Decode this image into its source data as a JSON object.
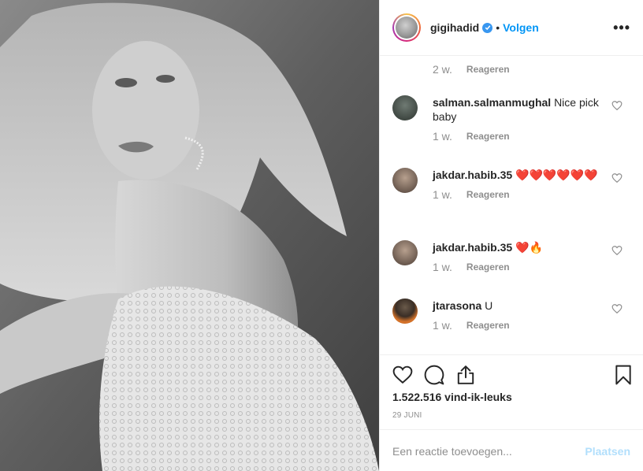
{
  "post": {
    "photo_icon": "photo"
  },
  "header": {
    "username": "gigihadid",
    "separator": "•",
    "follow_label": "Volgen",
    "more_icon": "more-dots-icon"
  },
  "caption_meta": {
    "time": "2 w.",
    "reply_label": "Reageren"
  },
  "comments": [
    {
      "username": "salman.salmanmughal",
      "text": "Nice pick baby",
      "time": "1 w.",
      "reply_label": "Reageren"
    },
    {
      "username": "jakdar.habib.35",
      "text": "❤️❤️❤️❤️❤️❤️",
      "time": "1 w.",
      "reply_label": "Reageren"
    },
    {
      "username": "jakdar.habib.35",
      "text": "❤️🔥",
      "time": "1 w.",
      "reply_label": "Reageren"
    },
    {
      "username": "jtarasona",
      "text": "U",
      "time": "1 w.",
      "reply_label": "Reageren"
    }
  ],
  "actions": {
    "likes": "1.522.516 vind-ik-leuks",
    "date": "29 JUNI"
  },
  "add_comment": {
    "placeholder": "Een reactie toevoegen...",
    "post_label": "Plaatsen"
  },
  "colors": {
    "accent": "#0095f6",
    "post_disabled": "#b2dffc",
    "muted_text": "#8e8e8e",
    "border": "#efefef"
  }
}
